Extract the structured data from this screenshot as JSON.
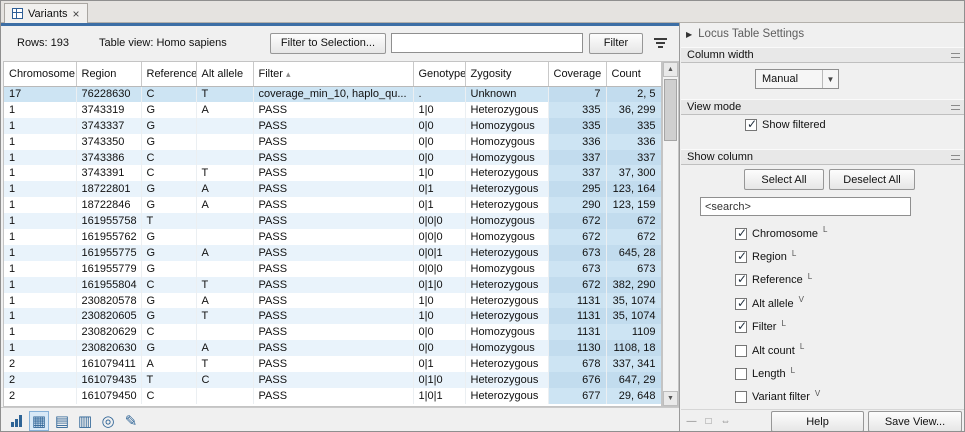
{
  "tab": {
    "title": "Variants",
    "close": "×"
  },
  "toolbar": {
    "rows": "Rows: 193",
    "view": "Table view: Homo sapiens",
    "filter_to_selection": "Filter to Selection...",
    "search_value": "",
    "filter": "Filter"
  },
  "table": {
    "columns": [
      "Chromosome",
      "Region",
      "Reference",
      "Alt allele",
      "Filter",
      "Genotype",
      "Zygosity",
      "Coverage",
      "Count"
    ],
    "sort_column": "Filter",
    "sort_indicator": "▴",
    "selected_row": 0,
    "rows": [
      [
        "17",
        "76228630",
        "C",
        "T",
        "coverage_min_10, haplo_qu...",
        ".",
        "Unknown",
        "7",
        "2, 5"
      ],
      [
        "1",
        "3743319",
        "G",
        "A",
        "PASS",
        "1|0",
        "Heterozygous",
        "335",
        "36, 299"
      ],
      [
        "1",
        "3743337",
        "G",
        "",
        "PASS",
        "0|0",
        "Homozygous",
        "335",
        "335"
      ],
      [
        "1",
        "3743350",
        "G",
        "",
        "PASS",
        "0|0",
        "Homozygous",
        "336",
        "336"
      ],
      [
        "1",
        "3743386",
        "C",
        "",
        "PASS",
        "0|0",
        "Homozygous",
        "337",
        "337"
      ],
      [
        "1",
        "3743391",
        "C",
        "T",
        "PASS",
        "1|0",
        "Heterozygous",
        "337",
        "37, 300"
      ],
      [
        "1",
        "18722801",
        "G",
        "A",
        "PASS",
        "0|1",
        "Heterozygous",
        "295",
        "123, 164"
      ],
      [
        "1",
        "18722846",
        "G",
        "A",
        "PASS",
        "0|1",
        "Heterozygous",
        "290",
        "123, 159"
      ],
      [
        "1",
        "161955758",
        "T",
        "",
        "PASS",
        "0|0|0",
        "Homozygous",
        "672",
        "672"
      ],
      [
        "1",
        "161955762",
        "G",
        "",
        "PASS",
        "0|0|0",
        "Homozygous",
        "672",
        "672"
      ],
      [
        "1",
        "161955775",
        "G",
        "A",
        "PASS",
        "0|0|1",
        "Heterozygous",
        "673",
        "645, 28"
      ],
      [
        "1",
        "161955779",
        "G",
        "",
        "PASS",
        "0|0|0",
        "Homozygous",
        "673",
        "673"
      ],
      [
        "1",
        "161955804",
        "C",
        "T",
        "PASS",
        "0|1|0",
        "Heterozygous",
        "672",
        "382, 290"
      ],
      [
        "1",
        "230820578",
        "G",
        "A",
        "PASS",
        "1|0",
        "Heterozygous",
        "1131",
        "35, 1074"
      ],
      [
        "1",
        "230820605",
        "G",
        "T",
        "PASS",
        "1|0",
        "Heterozygous",
        "1131",
        "35, 1074"
      ],
      [
        "1",
        "230820629",
        "C",
        "",
        "PASS",
        "0|0",
        "Homozygous",
        "1131",
        "1109"
      ],
      [
        "1",
        "230820630",
        "G",
        "A",
        "PASS",
        "0|0",
        "Homozygous",
        "1130",
        "1108, 18"
      ],
      [
        "2",
        "161079411",
        "A",
        "T",
        "PASS",
        "0|1",
        "Heterozygous",
        "678",
        "337, 341"
      ],
      [
        "2",
        "161079435",
        "T",
        "C",
        "PASS",
        "0|1|0",
        "Heterozygous",
        "676",
        "647, 29"
      ],
      [
        "2",
        "161079450",
        "C",
        "",
        "PASS",
        "1|0|1",
        "Heterozygous",
        "677",
        "29, 648"
      ]
    ]
  },
  "bottom_icons": {
    "names": [
      "statistics-icon",
      "table-view-icon",
      "track-list-icon",
      "spreadsheet-icon",
      "circular-view-icon",
      "editor-icon"
    ],
    "active_index": 1
  },
  "settings": {
    "title": "Locus Table Settings",
    "column_width": {
      "header": "Column width",
      "mode": "Manual"
    },
    "view_mode": {
      "header": "View mode",
      "show_filtered": "Show filtered",
      "show_filtered_checked": true
    },
    "show_column": {
      "header": "Show column",
      "select_all": "Select All",
      "deselect_all": "Deselect All",
      "search_value": "<search>",
      "items": [
        {
          "label": "Chromosome",
          "sup": "L",
          "checked": true
        },
        {
          "label": "Region",
          "sup": "L",
          "checked": true
        },
        {
          "label": "Reference",
          "sup": "L",
          "checked": true
        },
        {
          "label": "Alt allele",
          "sup": "V",
          "checked": true
        },
        {
          "label": "Filter",
          "sup": "L",
          "checked": true
        },
        {
          "label": "Alt count",
          "sup": "L",
          "checked": false
        },
        {
          "label": "Length",
          "sup": "L",
          "checked": false
        },
        {
          "label": "Variant filter",
          "sup": "V",
          "checked": false
        }
      ]
    },
    "footer": {
      "help": "Help",
      "save_view": "Save View...",
      "icon_names": [
        "collapse-panel-icon",
        "float-panel-icon",
        "dock-panel-icon"
      ]
    }
  },
  "colors": {
    "accent": "#3c6ea5",
    "row_alt": "#e9f3fb",
    "selection": "#cde4f3",
    "icon_blue": "#2e6496"
  }
}
